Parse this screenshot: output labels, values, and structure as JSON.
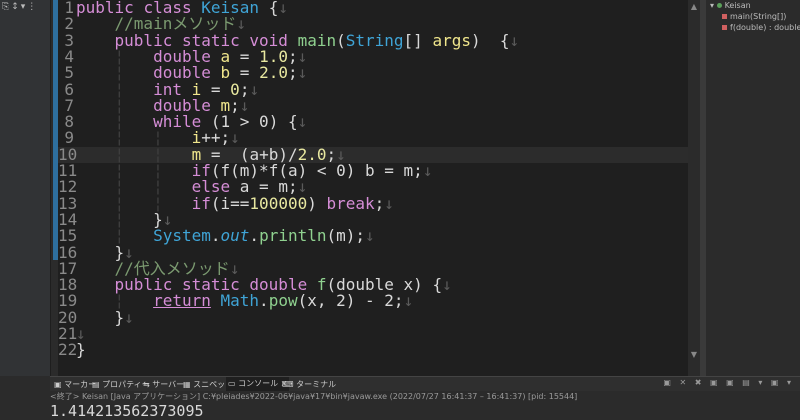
{
  "left_toolbar": {
    "icons": [
      "tool-icon-1",
      "tool-icon-2",
      "tool-icon-3"
    ]
  },
  "editor": {
    "ws_glyph": "¦",
    "eol_glyph": "↓",
    "line_numbers": [
      "1",
      "2",
      "3",
      "4",
      "5",
      "6",
      "7",
      "8",
      "9",
      "10",
      "11",
      "12",
      "13",
      "14",
      "15",
      "16",
      "17",
      "18",
      "19",
      "20",
      "21",
      "22"
    ],
    "tokens": {
      "public": "public",
      "class": "class",
      "class_name": "Keisan",
      "brace_open": "{",
      "brace_close": "}",
      "comment_main": "//mainメソッド",
      "static": "static",
      "void": "void",
      "main": "main",
      "string_type": "String",
      "array_args": "[] ",
      "args": "args",
      "paren_close_brace": ")",
      "double": "double",
      "a": "a",
      "b": "b",
      "assign": " = ",
      "one": "1.0",
      "two": "2.0",
      "semi": ";",
      "int": "int",
      "i": "i",
      "zero": "0",
      "m": "m",
      "while": "while",
      "while_cond": "(1 > 0) ",
      "i_incr": "++;",
      "m_expr_a": "(a+b)/",
      "two_b": "2.0",
      "if": "if",
      "f": "f",
      "if_expr": "(f(m)*f(a) < 0) b = m;",
      "else": "else",
      "else_expr": " a = m;",
      "if2_open": "(i==",
      "hundredk": "100000",
      "if2_close": ") ",
      "break": "break",
      "system": "System",
      "dot": ".",
      "out": "out",
      "println": "println",
      "println_args": "(m);",
      "comment_sub": "//代入メソッド",
      "f_sig": "(double x) ",
      "return": "return",
      "math": "Math",
      "pow": "pow",
      "pow_args": "(x, 2) - 2;"
    }
  },
  "outline": {
    "class_label": "Keisan",
    "method_main": "main(String[])",
    "method_f": "f(double) : double"
  },
  "bottom_tabs": {
    "markers": "マーカー",
    "properties": "プロパティー",
    "servers": "サーバー",
    "snippets": "スニペット",
    "console": "コンソール",
    "console_close": "×",
    "terminal": "ターミナル",
    "tools": "▣ ✕ ✖ ▣ ▣ ▤ ▾ ▣ ▾"
  },
  "console": {
    "header": "<終了> Keisan [Java アプリケーション] C:¥pleiades¥2022-06¥java¥17¥bin¥javaw.exe  (2022/07/27 16:41:37 – 16:41:37) [pid: 15544]",
    "output": "1.414213562373095"
  },
  "colors": {
    "keyword": "#d58dd6",
    "class": "#3fa4d6",
    "method": "#8fd18f",
    "number": "#e8e8a0",
    "variable": "#f0e68c",
    "comment": "#7b9a70",
    "editor_bg": "#1f1f1f"
  }
}
